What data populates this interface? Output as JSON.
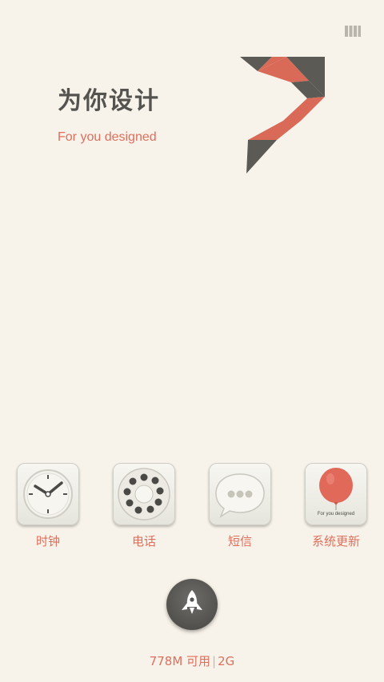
{
  "header": {
    "title": "为你设计",
    "subtitle": "For you designed"
  },
  "status": {
    "icon": "grid-columns-icon"
  },
  "apps": [
    {
      "label": "时钟",
      "icon": "clock-icon"
    },
    {
      "label": "电话",
      "icon": "rotary-phone-icon"
    },
    {
      "label": "短信",
      "icon": "message-bubble-icon"
    },
    {
      "label": "系统更新",
      "icon": "balloon-icon",
      "caption": "For you designed"
    }
  ],
  "launcher": {
    "icon": "rocket-icon"
  },
  "memory": {
    "available": "778M 可用",
    "network": "2G"
  },
  "colors": {
    "accent": "#de6f5c",
    "background": "#f8f3ea",
    "dark": "#55534f"
  }
}
